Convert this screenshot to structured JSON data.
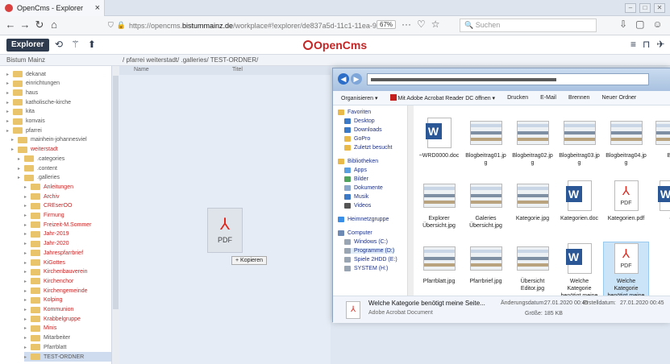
{
  "browser": {
    "tab_title": "OpenCms - Explorer",
    "tab_close": "×",
    "url_prefix": "https://opencms.",
    "url_domain": "bistummainz.de",
    "url_suffix": "/workplace#!explorer/de837a5d-11c1-11ea-9",
    "zoom": "67%",
    "search_placeholder": "Suchen"
  },
  "app": {
    "explorer_label": "Explorer",
    "logo_text": "OpenCms",
    "site_select": "Bistum Mainz",
    "path": "/ pfarrei weiterstadt/ .galleries/ TEST-ORDNER/",
    "col_name": "Name",
    "col_title": "Titel"
  },
  "tree": {
    "items": [
      {
        "label": "dekanat"
      },
      {
        "label": "einrichtungen"
      },
      {
        "label": "haus"
      },
      {
        "label": "katholische-kirche"
      },
      {
        "label": "kita"
      },
      {
        "label": "konvais"
      },
      {
        "label": "pfarrei"
      },
      {
        "label": "mainhein-johannesviel"
      },
      {
        "label": "weiterstadt"
      },
      {
        "label": ".categories"
      },
      {
        "label": ".content"
      },
      {
        "label": ".galleries"
      },
      {
        "label": "Anleitungen"
      },
      {
        "label": "Archiv"
      },
      {
        "label": "CREserOO"
      },
      {
        "label": "Firmung"
      },
      {
        "label": "Freizeit-M.Sommer"
      },
      {
        "label": "Jahr-2019"
      },
      {
        "label": "Jahr-2020"
      },
      {
        "label": "Jahrespfarrbrief"
      },
      {
        "label": "KiGottes"
      },
      {
        "label": "Kirchenbauverein"
      },
      {
        "label": "Kirchenchor"
      },
      {
        "label": "Kirchengemeinde"
      },
      {
        "label": "Kolping"
      },
      {
        "label": "Kommunion"
      },
      {
        "label": "Krabbelgruppe"
      },
      {
        "label": "Minis"
      },
      {
        "label": "Mitarbeiter"
      },
      {
        "label": "Pfarrblatt"
      },
      {
        "label": "TEST-ORDNER"
      }
    ]
  },
  "drag": {
    "pdf_label": "PDF",
    "tooltip": "+ Kopieren"
  },
  "explorer": {
    "toolbar": [
      "Organisieren ▾",
      "Mit Adobe Acrobat Reader DC öffnen ▾",
      "Drucken",
      "E-Mail",
      "Brennen",
      "Neuer Ordner"
    ],
    "nav": {
      "favorites": "Favoriten",
      "fav_items": [
        "Desktop",
        "Downloads",
        "GoPro",
        "Zuletzt besucht"
      ],
      "libraries": "Bibliotheken",
      "lib_items": [
        "Apps",
        "Bilder",
        "Dokumente",
        "Musik",
        "Videos"
      ],
      "homegroup": "Heimnetzgruppe",
      "computer": "Computer",
      "drives": [
        "Windows (C:)",
        "Programme (D:)",
        "Spiele 2HDD (E:)",
        "SYSTEM (H:)"
      ]
    },
    "files": [
      {
        "name": "~WRD0000.doc",
        "kind": "doc"
      },
      {
        "name": "Blogbeitrag01.jp g",
        "kind": "img"
      },
      {
        "name": "Blogbeitrag02.jp g",
        "kind": "img"
      },
      {
        "name": "Blogbeitrag03.jp g",
        "kind": "img"
      },
      {
        "name": "Blogbeitrag04.jp g",
        "kind": "img"
      },
      {
        "name": "Blo",
        "kind": "img"
      },
      {
        "name": "Explorer Übersicht.jpg",
        "kind": "img"
      },
      {
        "name": "Galeries Übersicht.jpg",
        "kind": "img"
      },
      {
        "name": "Kategorie.jpg",
        "kind": "img"
      },
      {
        "name": "Kategorien.doc",
        "kind": "doc"
      },
      {
        "name": "Kategorien.pdf",
        "kind": "pdf"
      },
      {
        "name": "e",
        "kind": "doc"
      },
      {
        "name": "Pfarrblatt.jpg",
        "kind": "img"
      },
      {
        "name": "Pfarrbrief.jpg",
        "kind": "img"
      },
      {
        "name": "Übersicht Editor.jpg",
        "kind": "img"
      },
      {
        "name": "Welche Kategorie benötigt meine",
        "kind": "doc"
      },
      {
        "name": "Welche Kategorie benötigt meine",
        "kind": "pdf"
      }
    ],
    "pdf_label": "PDF",
    "status": {
      "name": "Welche Kategorie benötigt meine Seite...",
      "type": "Adobe Acrobat Document",
      "changed_label": "Änderungsdatum:",
      "changed_value": "27.01.2020 00:45",
      "created_label": "Erstelldatum:",
      "created_value": "27.01.2020 00:45",
      "size_label": "Größe:",
      "size_value": "185 KB"
    }
  }
}
